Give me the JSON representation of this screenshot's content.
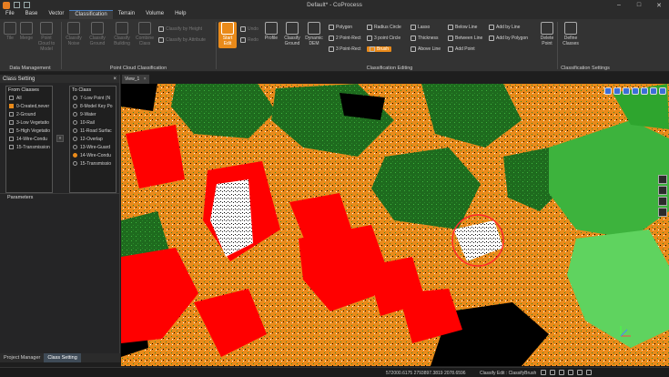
{
  "window": {
    "title": "Default* - CoProcess"
  },
  "menu": {
    "tabs": [
      "File",
      "Base",
      "Vector",
      "Classification",
      "Terrain",
      "Volume",
      "Help"
    ],
    "active": "Classification"
  },
  "ribbon": {
    "data_management": {
      "label": "Data Management",
      "buttons": [
        "Tile",
        "Merge",
        "Point Cloud to Model"
      ]
    },
    "pc_classification": {
      "label": "Point Cloud Classification",
      "buttons": [
        "Classify Noise",
        "Classify Ground",
        "Classify Building",
        "Combine Class"
      ],
      "small": [
        "Classify by Height",
        "Classify by Attribute"
      ]
    },
    "editing": {
      "label": "Classification Editing",
      "start_edit": "Start Edit",
      "undo": "Undo",
      "redo": "Redo",
      "profile": "Profile",
      "classify_ground": "Classify Ground",
      "dynamic_dem": "Dynamic DEM",
      "tools": {
        "polygon": "Polygon",
        "two_point_rect": "2 Point-Rect",
        "three_point_rect": "3 Point-Rect",
        "radius_circle": "Radius Circle",
        "three_point_circle": "3 point Circle",
        "brush": "Brush",
        "lasso": "Lasso",
        "thickness": "Thickness",
        "above_line": "Above Line",
        "below_line": "Below Line",
        "between_line": "Between Line",
        "add_point": "Add Point",
        "add_by_line": "Add by Line",
        "add_by_polygon": "Add by Polygon",
        "delete_point": "Delete Point"
      }
    },
    "settings": {
      "label": "Classification Settings",
      "define": "Define Classes"
    }
  },
  "class_setting": {
    "title": "Class Setting",
    "close": "×",
    "from_title": "From Classes",
    "from": [
      {
        "label": "All",
        "checked": false
      },
      {
        "label": "0-Created,never",
        "checked": true
      },
      {
        "label": "2-Ground",
        "checked": false
      },
      {
        "label": "3-Low Vegetatio",
        "checked": false
      },
      {
        "label": "5-High Vegetatio",
        "checked": false
      },
      {
        "label": "14-Wire-Condu",
        "checked": false
      },
      {
        "label": "15-Transmission",
        "checked": false
      }
    ],
    "move": "»",
    "to_title": "To Class",
    "to": [
      {
        "label": "7-Low Point (N",
        "selected": false
      },
      {
        "label": "8-Model Key Po",
        "selected": false
      },
      {
        "label": "9-Water",
        "selected": false
      },
      {
        "label": "10-Rail",
        "selected": false
      },
      {
        "label": "11-Road Surfac",
        "selected": false
      },
      {
        "label": "12-Overlap",
        "selected": false
      },
      {
        "label": "13-Wire-Guard",
        "selected": false
      },
      {
        "label": "14-Wire-Condu",
        "selected": true
      },
      {
        "label": "15-Transmissio",
        "selected": false
      }
    ],
    "parameters": "Parameters"
  },
  "bottom_tabs": [
    "Project Manager",
    "Class Setting"
  ],
  "view": {
    "tab": "View_1",
    "close": "×"
  },
  "status": {
    "coords": "572000.6175 2793897.3819 2078.6596",
    "mode": "Classify Edit : ClassifyBrush"
  },
  "colors": {
    "orange": "#e98a1a",
    "red": "#ff0000",
    "dark_green": "#1e6b1e",
    "green": "#3db33d",
    "bright_green": "#5fd35f",
    "white": "#ffffff",
    "accent": "#e98a1a"
  }
}
